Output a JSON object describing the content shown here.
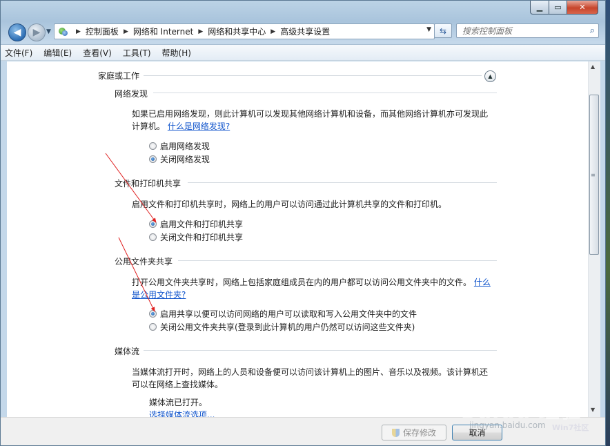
{
  "breadcrumb": [
    "控制面板",
    "网络和 Internet",
    "网络和共享中心",
    "高级共享设置"
  ],
  "search_placeholder": "搜索控制面板",
  "menu": [
    "文件(F)",
    "编辑(E)",
    "查看(V)",
    "工具(T)",
    "帮助(H)"
  ],
  "profile_title": "家庭或工作",
  "sections": {
    "discovery": {
      "title": "网络发现",
      "desc_line1": "如果已启用网络发现，则此计算机可以发现其他网络计算机和设备，而其他网络计算机亦可发现此",
      "desc_line2": "计算机。",
      "link": "什么是网络发现?",
      "opt_on": "启用网络发现",
      "opt_off": "关闭网络发现",
      "selected": "off"
    },
    "fileprint": {
      "title": "文件和打印机共享",
      "desc": "启用文件和打印机共享时，网络上的用户可以访问通过此计算机共享的文件和打印机。",
      "opt_on": "启用文件和打印机共享",
      "opt_off": "关闭文件和打印机共享",
      "selected": "on"
    },
    "public": {
      "title": "公用文件夹共享",
      "desc_line1": "打开公用文件夹共享时，网络上包括家庭组成员在内的用户都可以访问公用文件夹中的文件。",
      "link_part1": "什么",
      "link_part2": "是公用文件夹?",
      "opt_on": "启用共享以便可以访问网络的用户可以读取和写入公用文件夹中的文件",
      "opt_off": "关闭公用文件夹共享(登录到此计算机的用户仍然可以访问这些文件夹)",
      "selected": "on"
    },
    "media": {
      "title": "媒体流",
      "desc_line1": "当媒体流打开时，网络上的人员和设备便可以访问该计算机上的图片、音乐以及视频。该计算机还",
      "desc_line2": "可以在网络上查找媒体。",
      "status": "媒体流已打开。",
      "link": "选择媒体流选项..."
    }
  },
  "buttons": {
    "save": "保存修改",
    "cancel": "取消"
  },
  "watermark": {
    "main": "Baidu 经验",
    "url": "jingyan.baidu.com",
    "site": "Win7社区"
  }
}
